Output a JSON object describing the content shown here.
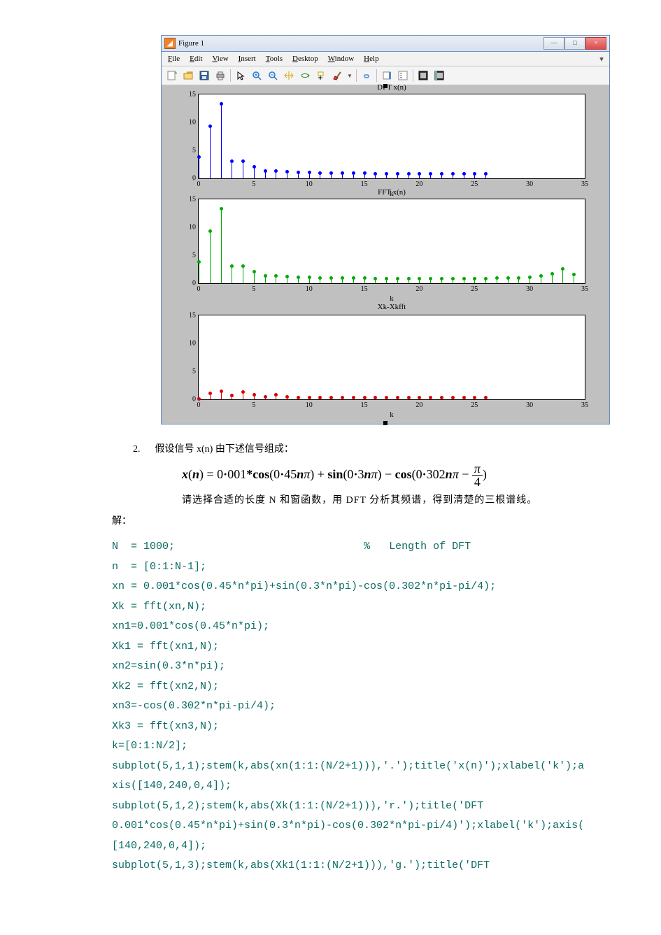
{
  "window": {
    "title": "Figure 1",
    "menus": [
      "File",
      "Edit",
      "View",
      "Insert",
      "Tools",
      "Desktop",
      "Window",
      "Help"
    ],
    "winbtn_min": "—",
    "winbtn_max": "□",
    "winbtn_close": "×"
  },
  "toolbar": {
    "items": [
      "new",
      "open",
      "save",
      "print",
      "sep",
      "pointer",
      "zoom-in",
      "zoom-out",
      "pan",
      "rotate",
      "data-cursor",
      "brush",
      "sep",
      "link",
      "sep",
      "insert-colorbar",
      "insert-legend",
      "sep",
      "hide-plot",
      "show-plot"
    ]
  },
  "chart_data": [
    {
      "type": "stem",
      "title": "DFT x(n)",
      "xlabel": "k",
      "color": "#0000ff",
      "xlim": [
        0,
        35
      ],
      "ylim": [
        0,
        15
      ],
      "xticks": [
        0,
        5,
        10,
        15,
        20,
        25,
        30,
        35
      ],
      "yticks": [
        0,
        5,
        10,
        15
      ],
      "x": [
        0,
        1,
        2,
        3,
        4,
        5,
        6,
        7,
        8,
        9,
        10,
        11,
        12,
        13,
        14,
        15,
        16,
        17,
        18,
        19,
        20,
        21,
        22,
        23,
        24,
        25,
        26
      ],
      "y": [
        3.7,
        9.3,
        13.2,
        3.0,
        3.0,
        2.0,
        1.2,
        1.2,
        1.1,
        1.0,
        1.0,
        0.9,
        0.9,
        0.9,
        0.9,
        0.9,
        0.8,
        0.8,
        0.8,
        0.8,
        0.8,
        0.8,
        0.8,
        0.8,
        0.8,
        0.8,
        0.8
      ]
    },
    {
      "type": "stem",
      "title": "FFT x(n)",
      "xlabel": "k\nXk-Xkfft",
      "color": "#00aa00",
      "xlim": [
        0,
        35
      ],
      "ylim": [
        0,
        15
      ],
      "xticks": [
        0,
        5,
        10,
        15,
        20,
        25,
        30,
        35
      ],
      "yticks": [
        0,
        5,
        10,
        15
      ],
      "x": [
        0,
        1,
        2,
        3,
        4,
        5,
        6,
        7,
        8,
        9,
        10,
        11,
        12,
        13,
        14,
        15,
        16,
        17,
        18,
        19,
        20,
        21,
        22,
        23,
        24,
        25,
        26,
        27,
        28,
        29,
        30,
        31,
        32,
        33,
        34
      ],
      "y": [
        3.7,
        9.3,
        13.2,
        3.0,
        3.0,
        2.0,
        1.2,
        1.2,
        1.1,
        1.0,
        1.0,
        0.9,
        0.9,
        0.9,
        0.9,
        0.9,
        0.8,
        0.8,
        0.8,
        0.8,
        0.8,
        0.8,
        0.8,
        0.8,
        0.8,
        0.8,
        0.8,
        0.9,
        0.9,
        0.9,
        1.0,
        1.2,
        1.6,
        2.5,
        1.5
      ]
    },
    {
      "type": "stem",
      "title": "",
      "xlabel": "k",
      "color": "#dd0000",
      "xlim": [
        0,
        35
      ],
      "ylim": [
        0,
        15
      ],
      "xticks": [
        0,
        5,
        10,
        15,
        20,
        25,
        30,
        35
      ],
      "yticks": [
        0,
        5,
        10,
        15
      ],
      "x": [
        0,
        1,
        2,
        3,
        4,
        5,
        6,
        7,
        8,
        9,
        10,
        11,
        12,
        13,
        14,
        15,
        16,
        17,
        18,
        19,
        20,
        21,
        22,
        23,
        24,
        25,
        26
      ],
      "y": [
        0,
        1.0,
        1.4,
        0.6,
        1.2,
        0.7,
        0.4,
        0.8,
        0.4,
        0.3,
        0.3,
        0.3,
        0.2,
        0.3,
        0.2,
        0.2,
        0.2,
        0.2,
        0.2,
        0.2,
        0.2,
        0.2,
        0.2,
        0.2,
        0.2,
        0.3,
        0.2
      ]
    }
  ],
  "question": {
    "num": "2.",
    "text_pre": "假设信号 x(n) 由下述信号组成：",
    "formula_plain": "x(n) = 0.001*cos(0.45nπ) + sin(0.3nπ) − cos(0.302nπ − π/4)",
    "text_post": "请选择合适的长度 N 和窗函数，用 DFT 分析其频谱，得到清楚的三根谱线。",
    "sol_label": "解："
  },
  "code_lines": [
    [
      "N  = 1000;",
      "                              ",
      "%   Length of DFT"
    ],
    [
      "n  = [0:1:N-1];"
    ],
    [
      "xn = 0.001*cos(0.45*n*pi)+sin(0.3*n*pi)-cos(0.302*n*pi-pi/4);"
    ],
    [
      "Xk = fft(xn,N);"
    ],
    [
      "xn1=0.001*cos(0.45*n*pi);"
    ],
    [
      "Xk1 = fft(xn1,N);"
    ],
    [
      "xn2=sin(0.3*n*pi);"
    ],
    [
      "Xk2 = fft(xn2,N);"
    ],
    [
      "xn3=-cos(0.302*n*pi-pi/4);"
    ],
    [
      "Xk3 = fft(xn3,N);"
    ],
    [
      "k=[0:1:N/2];"
    ],
    [
      "subplot(5,1,1);stem(k,abs(xn(1:1:(N/2+1))),'.');title('x(n)');xlabel('k');a"
    ],
    [
      "xis([140,240,0,4]);"
    ],
    [
      "subplot(5,1,2);stem(k,abs(Xk(1:1:(N/2+1))),'r.');title('DFT"
    ],
    [
      "0.001*cos(0.45*n*pi)+sin(0.3*n*pi)-cos(0.302*n*pi-pi/4)');xlabel('k');axis("
    ],
    [
      "[140,240,0,4]);"
    ],
    [
      "subplot(5,1,3);stem(k,abs(Xk1(1:1:(N/2+1))),'g.');title('DFT"
    ]
  ]
}
